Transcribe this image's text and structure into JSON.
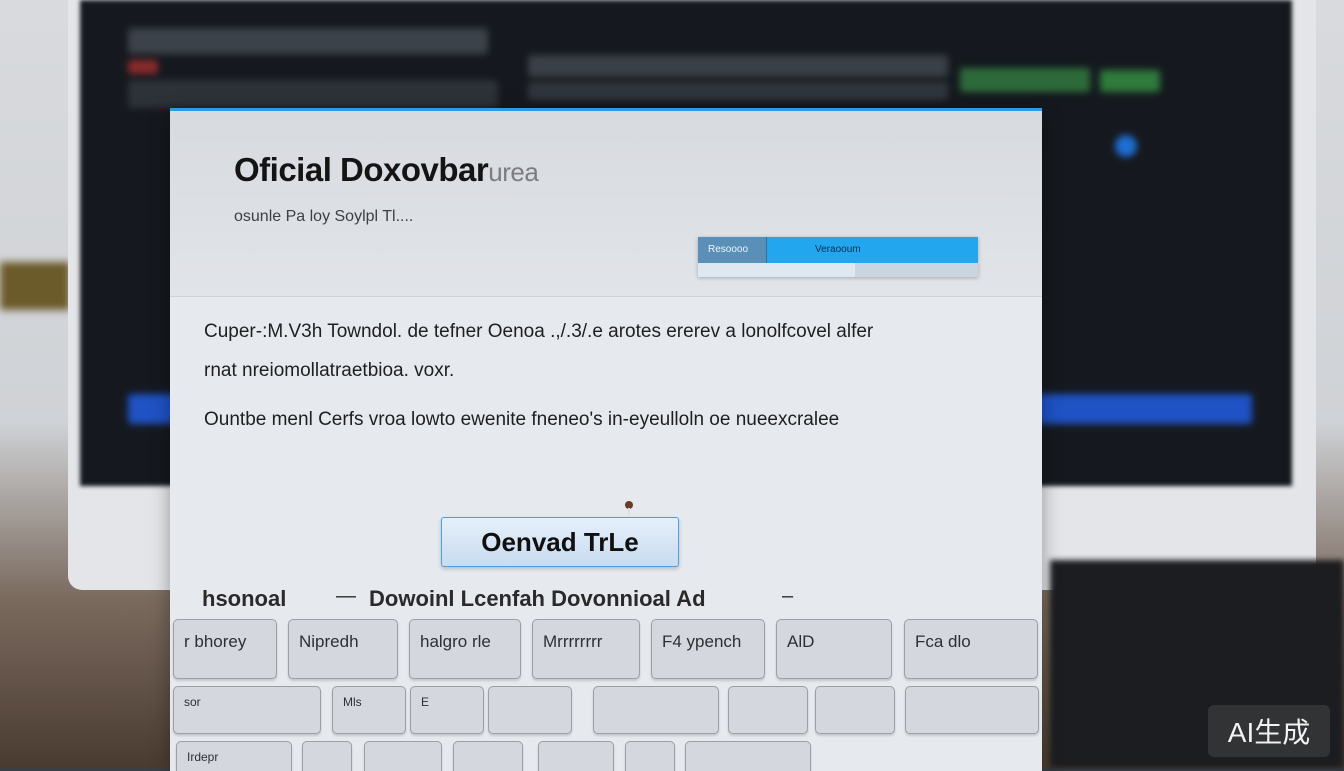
{
  "dialog": {
    "title": "Oficial Doxovbar",
    "title_tail": "urea",
    "subtitle": "osunle Pa loy Soylpl Tl....",
    "download_widget": {
      "segment_label": "Resoooo",
      "label": "Veraooum",
      "progress_fraction": 0.56
    },
    "paragraph_line_1": "Cuper-:M.V3h Towndol. de tefner Oenoa .,/.3/.e arotes ererev a lonolfcovel alfer",
    "paragraph_line_2": "rnat nreiomollatraetbioa. voxr.",
    "paragraph_line_3": "Ountbe menl Cerfs vroa lowto ewenite fneneo's in-eyeulloln oe nueexcralee",
    "open_button_label": "Oenvad TrLe",
    "footer_left": "hsonoal",
    "footer_dash_1": "—",
    "footer_main": "Dowoinl Lcenfah Dovonnioal Ad",
    "footer_dash_2": "–"
  },
  "keyboard": {
    "row1": [
      "r bhorey",
      "Nipredh",
      "halgro rle",
      "Mrrrrrrrr",
      "F4 ypench",
      "AlD",
      "Fca dlo"
    ],
    "row2": [
      "sor",
      "Mls",
      "E",
      "",
      "",
      "",
      "",
      ""
    ],
    "row3": [
      "Irdepr",
      "",
      "",
      "",
      "",
      "",
      ""
    ]
  },
  "watermark": "AI生成",
  "colors": {
    "accent_blue": "#22a7ef",
    "dialog_bg": "#e6e9ee",
    "button_border": "#4aa3e0"
  },
  "icons": {
    "cursor": "cursor-icon"
  }
}
